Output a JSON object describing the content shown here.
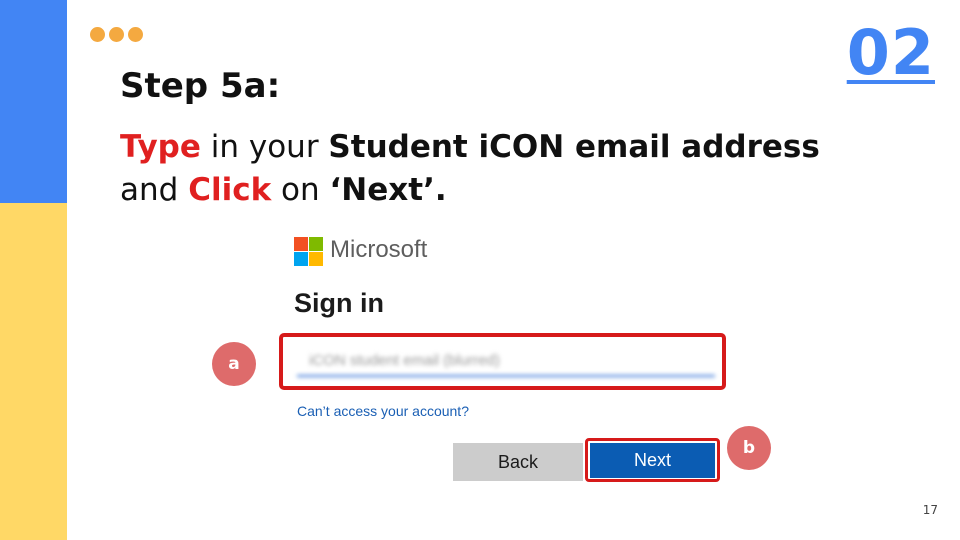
{
  "slide": {
    "section_number": "02",
    "page_number": "17",
    "step_title": "Step 5a:",
    "instruction": {
      "w1": "Type",
      "w2": " in your ",
      "w3": "Student iCON email address",
      "w4": "and ",
      "w5": "Click",
      "w6": " on ",
      "w7": "‘Next’."
    }
  },
  "signin": {
    "brand": "Microsoft",
    "title": "Sign in",
    "email_value": "iCON student email (blurred)",
    "account_link": "Can’t access your account?",
    "back_label": "Back",
    "next_label": "Next"
  },
  "callouts": {
    "a": "a",
    "b": "b"
  },
  "colors": {
    "accent_blue": "#4285f4",
    "accent_yellow": "#ffd866",
    "highlight_red": "#d61a1a",
    "badge_red": "#de6b6b",
    "next_blue": "#0b5cb3"
  },
  "icons": {
    "ms_logo": "microsoft-logo-icon",
    "dots": "decorative-dots-icon"
  }
}
